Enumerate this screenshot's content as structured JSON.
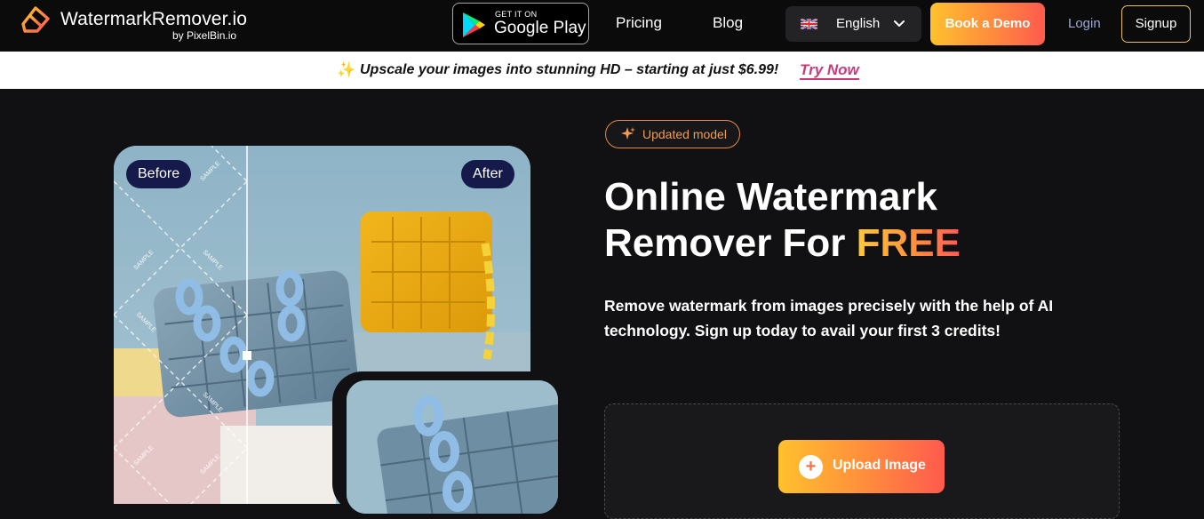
{
  "nav": {
    "brand_name": "WatermarkRemover.io",
    "brand_by": "by PixelBin.io",
    "google_play_small": "GET IT ON",
    "google_play_big": "Google Play",
    "links": [
      "Pricing",
      "Blog"
    ],
    "language": "English",
    "book_demo": "Book a Demo",
    "login": "Login",
    "signup": "Signup"
  },
  "promo": {
    "icon": "sparkle-icon",
    "text": "Upscale your images into stunning HD – starting at just $6.99!",
    "link": "Try Now"
  },
  "hero": {
    "before_label": "Before",
    "after_label": "After",
    "watermark_text": "SAMPLE",
    "badge": "Updated model",
    "title_line1": "Online Watermark",
    "title_line2_prefix": "Remover For ",
    "title_highlight": "FREE",
    "subtitle": "Remove watermark from images precisely with the help of AI technology. Sign up today to avail your first 3 credits!",
    "upload_button": "Upload Image"
  },
  "colors": {
    "background": "#111113",
    "accent_gradient_start": "#ffc12e",
    "accent_gradient_end": "#ff5a4e",
    "promo_link": "#c93a7a",
    "pill_bg": "#151a4a"
  }
}
